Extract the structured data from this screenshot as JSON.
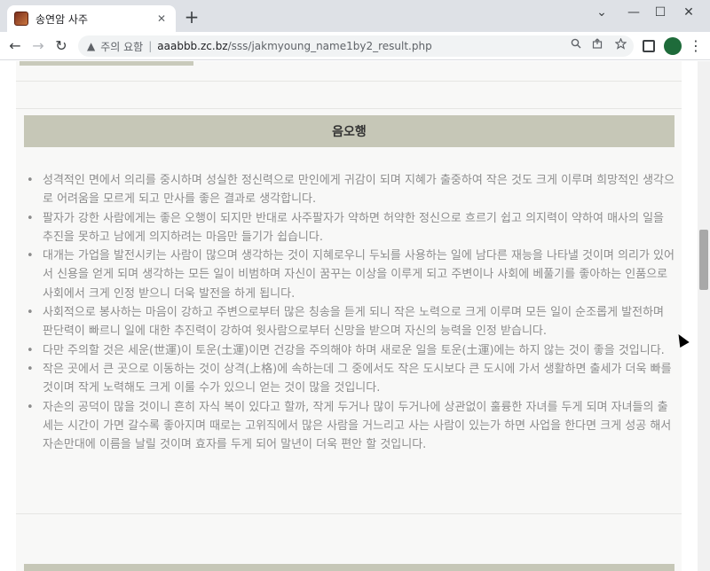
{
  "browser": {
    "tab_title": "송연암 사주",
    "tab_close": "✕",
    "new_tab": "+",
    "window_controls": {
      "chevron": "⌄",
      "minimize": "—",
      "maximize": "☐",
      "close": "✕"
    },
    "nav": {
      "back": "←",
      "forward": "→",
      "reload": "↻"
    },
    "address": {
      "security_icon": "▲",
      "security_text": "주의 요함",
      "separator": "|",
      "host": "aaabbb.zc.bz",
      "path": "/sss/jakmyoung_name1by2_result.php"
    },
    "icons": {
      "zoom": "search-icon",
      "share": "share-icon",
      "bookmark": "star-icon",
      "extensions": "extension-icon",
      "menu": "kebab-menu-icon"
    }
  },
  "section": {
    "title": "음오행",
    "items": [
      "성격적인 면에서 의리를 중시하며 성실한 정신력으로 만인에게 귀감이 되며 지혜가 출중하여 작은 것도 크게 이루며 희망적인 생각으로 어려움을 모르게 되고 만사를 좋은 결과로 생각합니다.",
      "팔자가 강한 사람에게는 좋은 오행이 되지만 반대로 사주팔자가 약하면 허약한 정신으로 흐르기 쉽고 의지력이 약하여 매사의 일을 추진을 못하고 남에게 의지하려는 마음만 들기가 쉽습니다.",
      "대개는 가업을 발전시키는 사람이 많으며 생각하는 것이 지혜로우니 두뇌를 사용하는 일에 남다른 재능을 나타낼 것이며 의리가 있어서 신용을 얻게 되며 생각하는 모든 일이 비범하며 자신이 꿈꾸는 이상을 이루게 되고 주변이나 사회에 베풀기를 좋아하는 인품으로 사회에서 크게 인정 받으니 더욱 발전을 하게 됩니다.",
      "사회적으로 봉사하는 마음이 강하고 주변으로부터 많은 칭송을 듣게 되니 작은 노력으로 크게 이루며 모든 일이 순조롭게 발전하며 판단력이 빠르니 일에 대한 추진력이 강하여 윗사람으로부터 신망을 받으며 자신의 능력을 인정 받습니다.",
      "다만 주의할 것은 세운(世運)이 토운(土運)이면 건강을 주의해야 하며 새로운 일을 토운(土運)에는 하지 않는 것이 좋을 것입니다.",
      "작은 곳에서 큰 곳으로 이동하는 것이 상격(上格)에 속하는데 그 중에서도 작은 도시보다 큰 도시에 가서 생활하면 출세가 더욱 빠를 것이며 작게 노력해도 크게 이룰 수가 있으니 얻는 것이 많을 것입니다.",
      "자손의 공덕이 많을 것이니 흔히 자식 복이 있다고 할까, 작게 두거나 많이 두거나에 상관없이 훌륭한 자녀를 두게 되며 자녀들의 출세는 시간이 가면 갈수록 좋아지며 때로는 고위직에서 많은 사람을 거느리고 사는 사람이 있는가 하면 사업을 한다면 크게 성공 해서 자손만대에 이름을 날릴 것이며 효자를 두게 되어 말년이 더욱 편안 할 것입니다."
    ]
  }
}
